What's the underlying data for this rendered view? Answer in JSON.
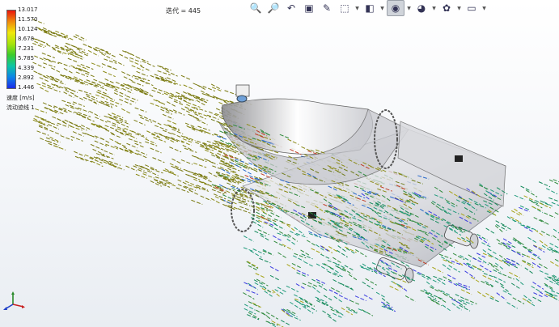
{
  "legend": {
    "ticks": [
      "13.017",
      "11.570",
      "10.124",
      "8.678",
      "7.231",
      "5.785",
      "4.339",
      "2.892",
      "1.446"
    ],
    "quantity_label": "速度 [m/s]",
    "trajectory_label": "流动迹线 1",
    "colors": [
      "#e8150e",
      "#f08a0c",
      "#f0e80c",
      "#a8e40c",
      "#3ccc2c",
      "#0cc6a4",
      "#0c84e8",
      "#1c2ce8"
    ]
  },
  "iteration": {
    "label": "迭代 = 445"
  },
  "toolbar": {
    "buttons": [
      {
        "name": "zoom-to-fit-icon",
        "glyph": "🔍",
        "dropdown": false
      },
      {
        "name": "zoom-to-area-icon",
        "glyph": "🔎",
        "dropdown": false
      },
      {
        "name": "previous-view-icon",
        "glyph": "↶",
        "dropdown": false
      },
      {
        "name": "section-view-icon",
        "glyph": "▣",
        "dropdown": false
      },
      {
        "name": "dynamic-annotation-icon",
        "glyph": "✎",
        "dropdown": false
      },
      {
        "name": "view-orientation-icon",
        "glyph": "⬚",
        "dropdown": true
      },
      {
        "name": "display-style-icon",
        "glyph": "◧",
        "dropdown": true
      },
      {
        "name": "hide-show-items-icon",
        "glyph": "◉",
        "dropdown": true
      },
      {
        "name": "edit-appearance-icon",
        "glyph": "◕",
        "dropdown": true
      },
      {
        "name": "apply-scene-icon",
        "glyph": "✿",
        "dropdown": true
      },
      {
        "name": "view-settings-icon",
        "glyph": "▭",
        "dropdown": true
      }
    ]
  },
  "scene": {
    "arrow_colors": [
      "#7a7a12",
      "#8b8a16",
      "#6f7c1a",
      "#2f8a3c",
      "#1f9a7a",
      "#148a5a",
      "#2a6acb",
      "#3a3ae0",
      "#c03a22",
      "#a6a316"
    ]
  }
}
